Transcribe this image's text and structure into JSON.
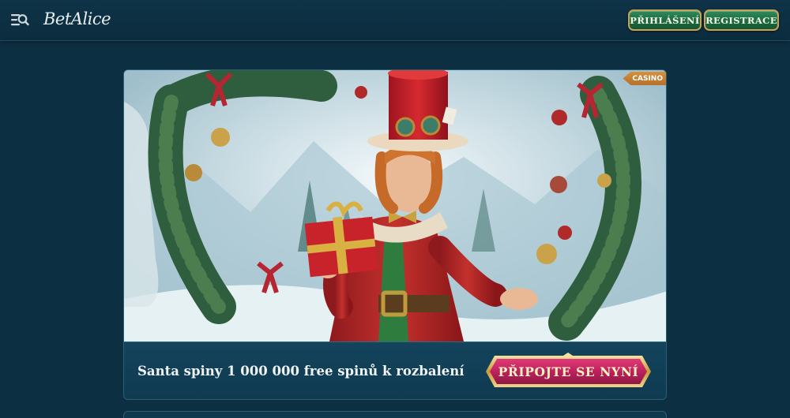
{
  "header": {
    "logo_text": "BetAlice",
    "login_label": "PŘIHLÁŠENÍ",
    "register_label": "REGISTRACE",
    "menu_icon": "menu-search-icon"
  },
  "promo": {
    "tag": "CASINO",
    "title": "Santa spiny 1 000 000 free spinů k rozbalení",
    "cta_label": "PŘIPOJTE SE NYNÍ",
    "hero_image": "elf-with-gift-and-wreaths"
  },
  "colors": {
    "background": "#0d2f42",
    "button_green": "#1d6a40",
    "button_border": "#c9a25a",
    "cta_pink": "#c2275f",
    "tag_orange": "#c9812f"
  }
}
